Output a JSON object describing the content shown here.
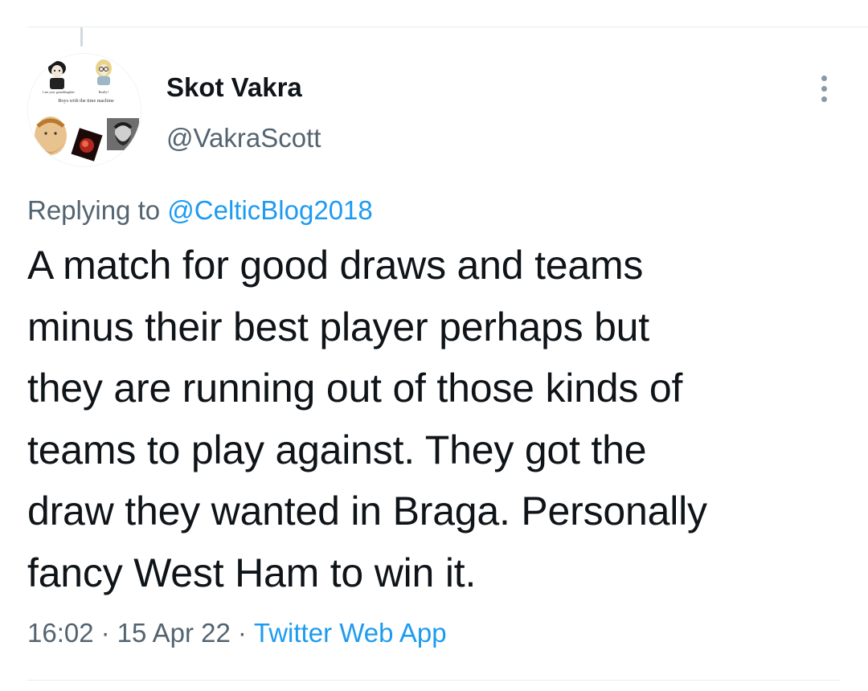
{
  "tweet": {
    "author": {
      "display_name": "Skot Vakra",
      "handle": "@VakraScott",
      "avatar_captions": {
        "left_small": "I am your granddaughter",
        "right_small": "Really?",
        "wide": "Boys with the time machine"
      }
    },
    "reply_context": {
      "prefix": "Replying to",
      "mention": "@CelticBlog2018"
    },
    "text_lines": [
      "A match for good draws and teams",
      "minus their best player perhaps but",
      "they are running out of those kinds of",
      "teams to play against. They got the",
      "draw they wanted in Braga. Personally",
      "fancy West Ham to win it."
    ],
    "time": "16:02",
    "separator": "·",
    "date": "15 Apr 22",
    "source": "Twitter Web App",
    "more_icon": "more-vertical-icon"
  },
  "colors": {
    "text_primary": "#0f1419",
    "text_secondary": "#536471",
    "link": "#1d9bf0",
    "divider": "#e6ecf0"
  }
}
